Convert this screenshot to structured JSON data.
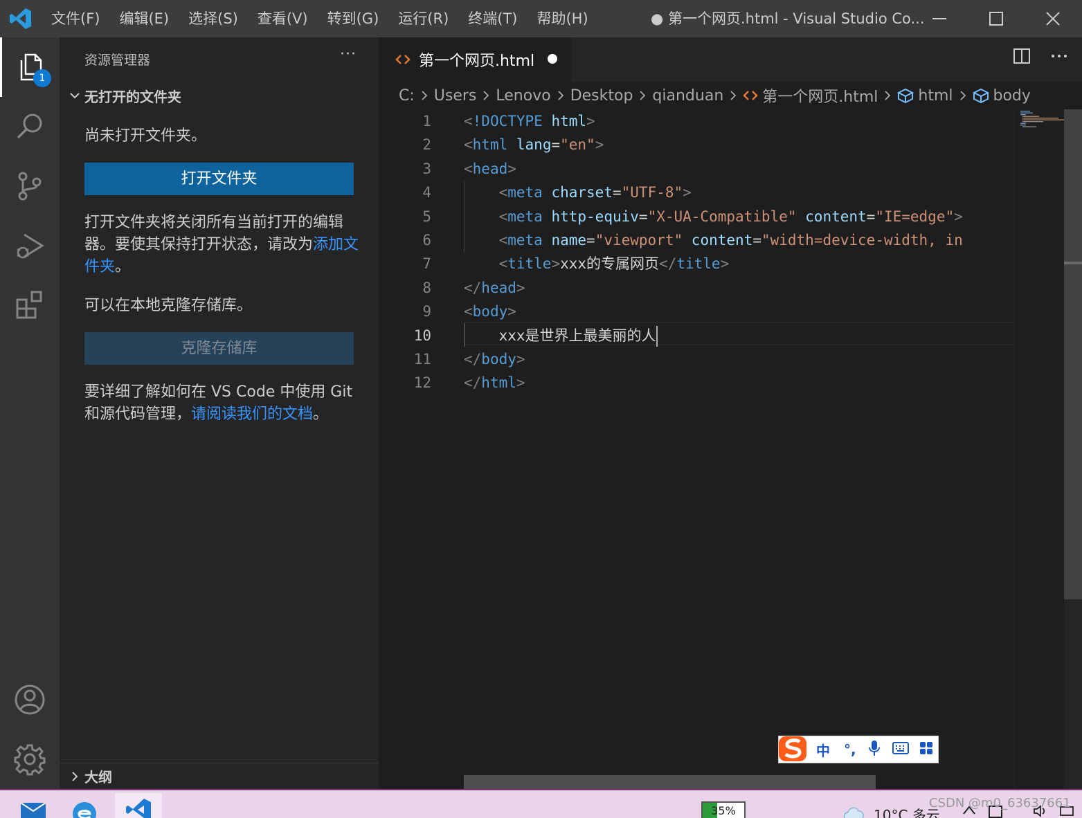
{
  "titlebar": {
    "menu": [
      "文件(F)",
      "编辑(E)",
      "选择(S)",
      "查看(V)",
      "转到(G)",
      "运行(R)",
      "终端(T)",
      "帮助(H)"
    ],
    "title": "● 第一个网页.html - Visual Studio Co..."
  },
  "activitybar": {
    "items": [
      "explorer-icon",
      "search-icon",
      "source-control-icon",
      "run-debug-icon",
      "extensions-icon",
      "account-icon",
      "settings-gear-icon"
    ],
    "explorer_badge": "1"
  },
  "sidebar": {
    "header": "资源管理器",
    "more": "···",
    "section_title": "无打开的文件夹",
    "no_folder_text": "尚未打开文件夹。",
    "open_folder_button": "打开文件夹",
    "open_folder_desc": "打开文件夹将关闭所有当前打开的编辑器。要使其保持打开状态，请改为",
    "add_folder_link": "添加文件夹",
    "period": "。",
    "clone_text": "可以在本地克隆存储库。",
    "clone_button": "克隆存储库",
    "learn_text": "要详细了解如何在 VS Code 中使用 Git 和源代码管理，",
    "docs_link": "请阅读我们的文档",
    "outline_title": "大纲"
  },
  "editor": {
    "tab_label": "第一个网页.html",
    "breadcrumb": [
      "C:",
      "Users",
      "Lenovo",
      "Desktop",
      "qianduan",
      "第一个网页.html",
      "html",
      "body"
    ],
    "line_numbers": [
      "1",
      "2",
      "3",
      "4",
      "5",
      "6",
      "7",
      "8",
      "9",
      "10",
      "11",
      "12"
    ],
    "current_line": "10",
    "code": {
      "l1": {
        "doctype": "!DOCTYPE",
        "html": "html"
      },
      "l2": {
        "tag": "html",
        "attr": "lang",
        "val": "\"en\""
      },
      "l3": {
        "tag": "head"
      },
      "l4": {
        "tag": "meta",
        "attr": "charset",
        "val": "\"UTF-8\""
      },
      "l5": {
        "tag": "meta",
        "attr1": "http-equiv",
        "val1": "\"X-UA-Compatible\"",
        "attr2": "content",
        "val2": "\"IE=edge\""
      },
      "l6": {
        "tag": "meta",
        "attr1": "name",
        "val1": "\"viewport\"",
        "attr2": "content",
        "val2": "\"width=device-width, in"
      },
      "l7": {
        "tag": "title",
        "text": "xxx的专属网页"
      },
      "l8": {
        "tag": "head"
      },
      "l9": {
        "tag": "body"
      },
      "l10": {
        "text": "xxx是世界上最美丽的人"
      },
      "l11": {
        "tag": "body"
      },
      "l12": {
        "tag": "html"
      }
    }
  },
  "ime": {
    "lang": "中",
    "punct": "°,",
    "icons": [
      "microphone-icon",
      "keyboard-icon",
      "toolbox-icon"
    ]
  },
  "taskbar": {
    "apps": [
      "mail-icon",
      "browser-icon",
      "vscode-icon"
    ],
    "battery": "35%",
    "battery_level": 0.35,
    "weather": "10°C 多云",
    "watermark": "CSDN @m0_63637661"
  },
  "colors": {
    "accent": "#0e639c",
    "link": "#3794ff",
    "tag": "#569cd6",
    "attr": "#9cdcfe",
    "string": "#ce9178"
  }
}
